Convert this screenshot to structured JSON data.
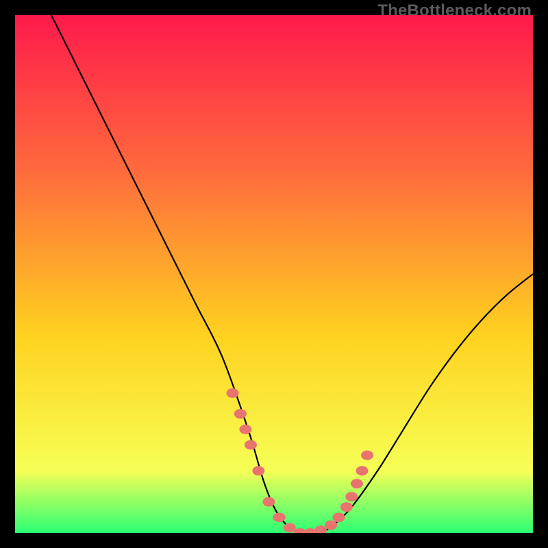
{
  "watermark": "TheBottleneck.com",
  "colors": {
    "bg": "#000000",
    "gradient_top": "#ff1a4b",
    "gradient_mid1": "#ff6a3d",
    "gradient_mid2": "#ffd21f",
    "gradient_mid3": "#f6ff55",
    "gradient_bottom": "#2bff73",
    "curve": "#000000",
    "marker": "#e8736f"
  },
  "chart_data": {
    "type": "line",
    "title": "",
    "xlabel": "",
    "ylabel": "",
    "xlim": [
      0,
      100
    ],
    "ylim": [
      0,
      100
    ],
    "series": [
      {
        "name": "bottleneck-curve",
        "x": [
          7,
          10,
          15,
          20,
          25,
          30,
          35,
          40,
          45,
          48,
          50,
          52,
          54,
          56,
          58,
          60,
          62,
          65,
          70,
          75,
          80,
          85,
          90,
          95,
          100
        ],
        "y": [
          100,
          94,
          84,
          74,
          64,
          54,
          44,
          34,
          20,
          10,
          5,
          2,
          0.5,
          0,
          0,
          0.5,
          2,
          5,
          12,
          20,
          28,
          35,
          41,
          46,
          50
        ]
      }
    ],
    "markers": {
      "name": "highlight-dots",
      "x": [
        42,
        43.5,
        44.5,
        45.5,
        47,
        49,
        51,
        53,
        55,
        57,
        59,
        61,
        62.5,
        64,
        65,
        66,
        67,
        68
      ],
      "y": [
        27,
        23,
        20,
        17,
        12,
        6,
        3,
        1,
        0,
        0,
        0.5,
        1.5,
        3,
        5,
        7,
        9.5,
        12,
        15
      ]
    }
  }
}
